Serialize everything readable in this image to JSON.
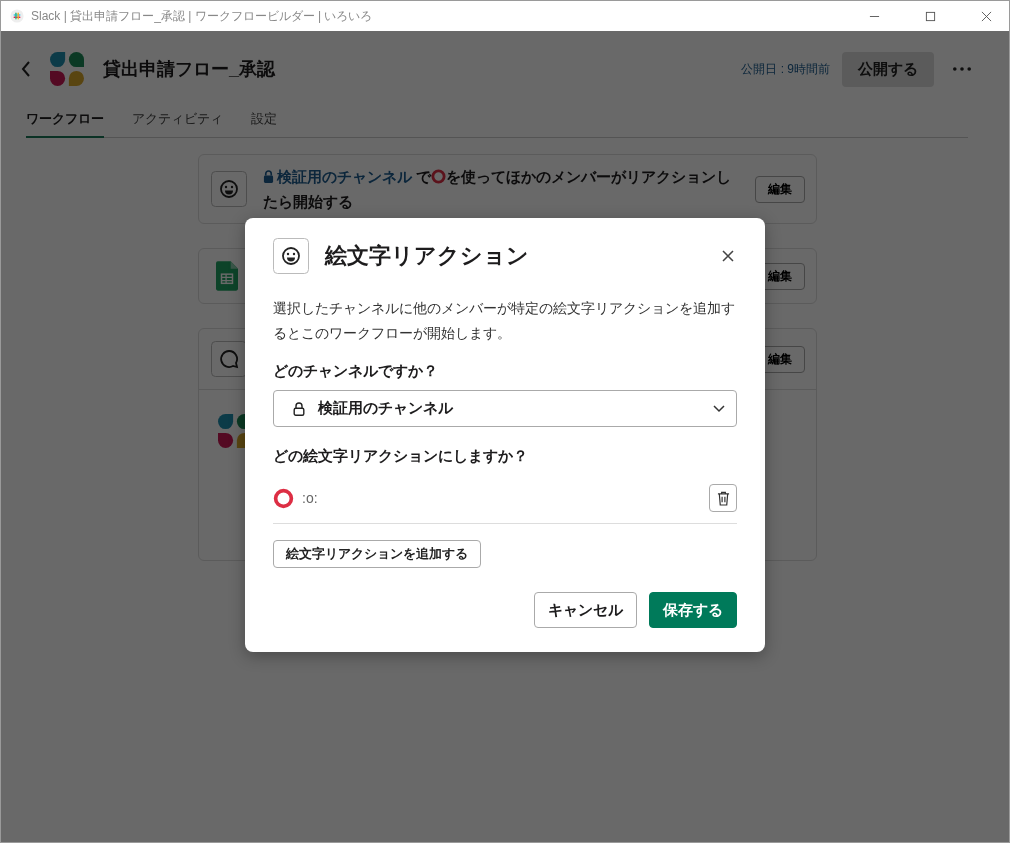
{
  "window": {
    "title": "Slack | 貸出申請フロー_承認 | ワークフロービルダー | いろいろ"
  },
  "header": {
    "title": "貸出申請フロー_承認",
    "published": "公開日 : 9時間前",
    "publish_button": "公開する"
  },
  "tabs": [
    {
      "label": "ワークフロー",
      "selected": true
    },
    {
      "label": "アクティビティ",
      "selected": false
    },
    {
      "label": "設定",
      "selected": false
    }
  ],
  "steps": [
    {
      "kind": "trigger",
      "channel": "検証用のチャンネル",
      "text_before": " で",
      "text_after": "を使ってほかのメンバーがリアクションしたら開始する",
      "edit": "編集"
    },
    {
      "kind": "sheet",
      "edit": "編集"
    },
    {
      "kind": "message",
      "edit": "編集"
    }
  ],
  "modal": {
    "title": "絵文字リアクション",
    "description": "選択したチャンネルに他のメンバーが特定の絵文字リアクションを追加するとこのワークフローが開始します。",
    "channel_label": "どのチャンネルですか？",
    "channel_value": "検証用のチャンネル",
    "emoji_label": "どの絵文字リアクションにしますか？",
    "emojis": [
      {
        "code": ":o:"
      }
    ],
    "add_button": "絵文字リアクションを追加する",
    "cancel": "キャンセル",
    "save": "保存する"
  }
}
